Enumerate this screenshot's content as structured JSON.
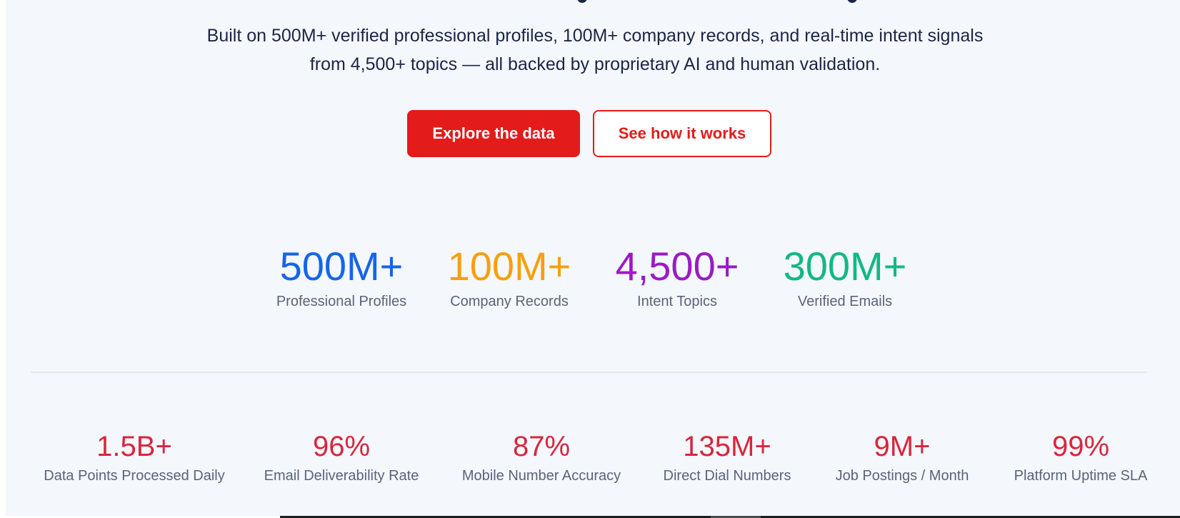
{
  "hero": {
    "subtitle_line1": "Built on 500M+ verified professional profiles, 100M+ company records, and real-time intent signals",
    "subtitle_line2": "from 4,500+ topics — all backed by proprietary AI and human validation."
  },
  "buttons": {
    "primary_label": "Explore the data",
    "secondary_label": "See how it works"
  },
  "primary_stats": [
    {
      "value": "500M+",
      "label": "Professional Profiles",
      "color": "#1565e8"
    },
    {
      "value": "100M+",
      "label": "Company Records",
      "color": "#f5a00f"
    },
    {
      "value": "4,500+",
      "label": "Intent Topics",
      "color": "#9b1bc4"
    },
    {
      "value": "300M+",
      "label": "Verified Emails",
      "color": "#12b886"
    }
  ],
  "secondary_stats": [
    {
      "value": "1.5B+",
      "label": "Data Points Processed Daily"
    },
    {
      "value": "96%",
      "label": "Email Deliverability Rate"
    },
    {
      "value": "87%",
      "label": "Mobile Number Accuracy"
    },
    {
      "value": "135M+",
      "label": "Direct Dial Numbers"
    },
    {
      "value": "9M+",
      "label": "Job Postings / Month"
    },
    {
      "value": "99%",
      "label": "Platform Uptime SLA"
    }
  ],
  "colors": {
    "accent_red": "#e31b1b",
    "secondary_stat_color": "#d7263d",
    "text_dark": "#1c2545",
    "text_muted": "#5b6379",
    "background": "#f4f7fc"
  }
}
